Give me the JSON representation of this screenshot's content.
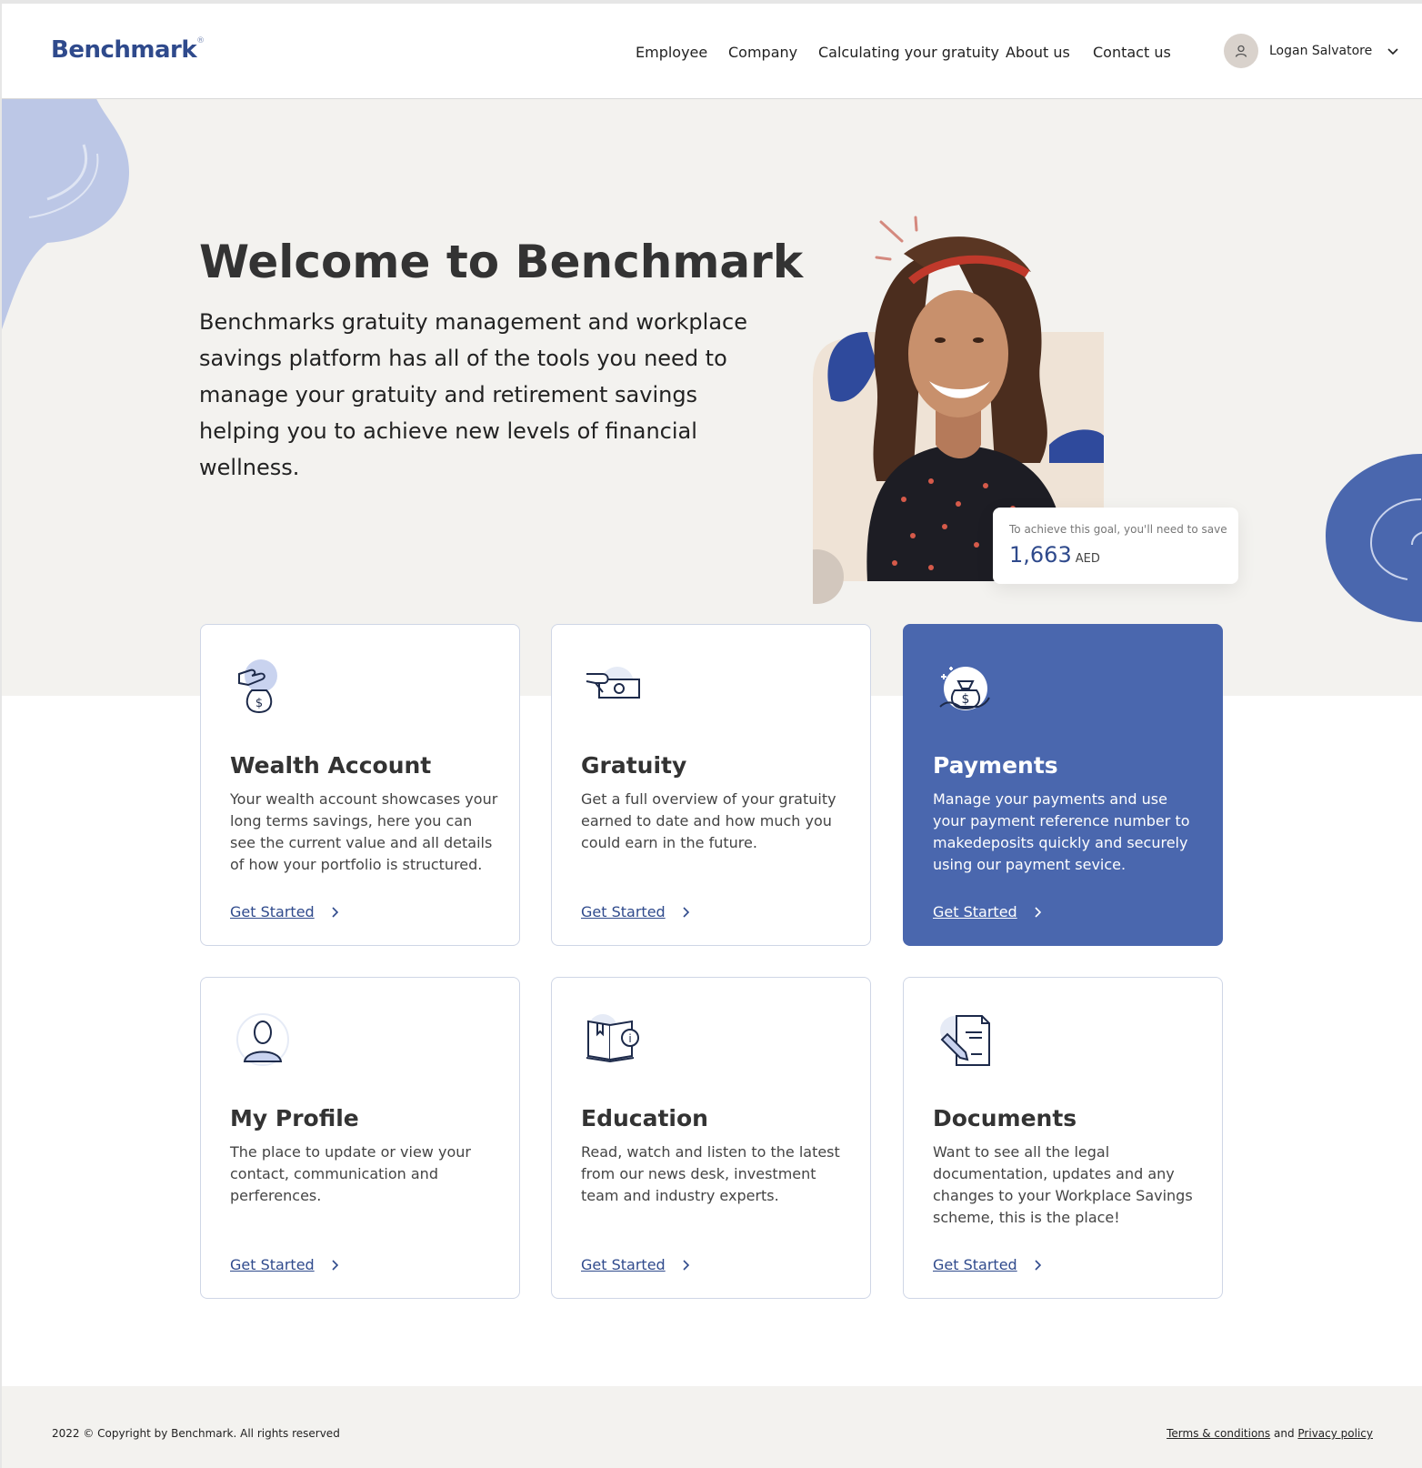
{
  "brand": {
    "name": "Benchmark",
    "mark": "®"
  },
  "nav": [
    {
      "label": "Employee"
    },
    {
      "label": "Company"
    },
    {
      "label": "Calculating your gratuity"
    },
    {
      "label": "About us"
    },
    {
      "label": "Contact us"
    }
  ],
  "user": {
    "name": "Logan Salvatore"
  },
  "hero": {
    "title": "Welcome to Benchmark",
    "description": "Benchmarks gratuity management and workplace savings platform has all of the tools you need to manage your gratuity and retirement savings helping you to achieve new levels of financial wellness.",
    "goal": {
      "label": "To achieve this goal, you'll need to save",
      "value": "1,663",
      "unit": "AED"
    }
  },
  "cards": [
    {
      "title": "Wealth Account",
      "description": "Your wealth account showcases your long terms savings, here you can see the current value and all details of how your portfolio is structured.",
      "cta": "Get Started",
      "icon": "money-bag-hand-icon"
    },
    {
      "title": "Gratuity",
      "description": "Get a full overview of your gratuity earned to date and how much you could earn in the future.",
      "cta": "Get Started",
      "icon": "cash-hand-icon"
    },
    {
      "title": "Payments",
      "description": "Manage your payments and use your payment reference number to makedeposits quickly and securely using our payment sevice.",
      "cta": "Get Started",
      "icon": "money-bag-palm-icon"
    },
    {
      "title": "My Profile",
      "description": "The place to update or view your contact,  communication and perferences.",
      "cta": "Get Started",
      "icon": "user-profile-icon"
    },
    {
      "title": "Education",
      "description": "Read, watch and listen to the latest from our news desk, investment team and industry experts.",
      "cta": "Get Started",
      "icon": "book-info-icon"
    },
    {
      "title": "Documents",
      "description": "Want  to see all the legal documentation, updates and any changes to your Workplace Savings scheme, this is the place!",
      "cta": "Get Started",
      "icon": "document-pen-icon"
    }
  ],
  "footer": {
    "copyright": "2022 © Copyright by Benchmark. All rights reserved",
    "terms": "Terms & conditions",
    "and": "and",
    "privacy": "Privacy policy"
  },
  "colors": {
    "brand": "#2f4a8c",
    "featured": "#4a67ae",
    "hero_bg": "#f3f2ef"
  }
}
